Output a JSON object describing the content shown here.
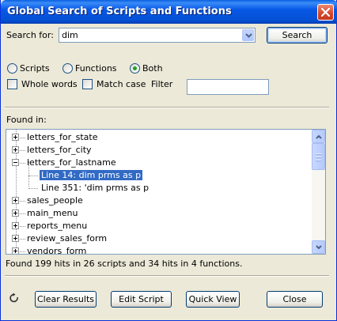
{
  "window": {
    "title": "Global Search of Scripts and Functions"
  },
  "search": {
    "label": "Search for:",
    "value": "dim",
    "button": "Search"
  },
  "options": {
    "scripts": "Scripts",
    "functions": "Functions",
    "both": "Both",
    "selected_scope": "Both",
    "whole_words": "Whole words",
    "match_case": "Match case",
    "filter_label": "Filter",
    "filter_value": ""
  },
  "results": {
    "label": "Found in:",
    "items": [
      {
        "label": "letters_for_state",
        "expanded": false
      },
      {
        "label": "letters_for_city",
        "expanded": false
      },
      {
        "label": "letters_for_lastname",
        "expanded": true
      },
      {
        "label": "Line 14: dim prms as p",
        "child": true,
        "selected": true
      },
      {
        "label": "Line 351: 'dim prms as p",
        "child": true
      },
      {
        "label": "sales_people",
        "expanded": false
      },
      {
        "label": "main_menu",
        "expanded": false
      },
      {
        "label": "reports_menu",
        "expanded": false
      },
      {
        "label": "review_sales_form",
        "expanded": false
      },
      {
        "label": "vendors_form",
        "expanded": false
      }
    ],
    "summary": "Found 199 hits in 26 scripts and 34 hits in 4 functions."
  },
  "buttons": {
    "clear": "Clear Results",
    "edit": "Edit Script",
    "quick_view": "Quick View",
    "close": "Close"
  },
  "icons": {
    "close": "close-icon",
    "dropdown": "chevron-down-icon",
    "refresh": "refresh-icon"
  },
  "colors": {
    "title_bar": "#0858e6",
    "selection": "#316ac5",
    "window_bg": "#ece9d8"
  }
}
